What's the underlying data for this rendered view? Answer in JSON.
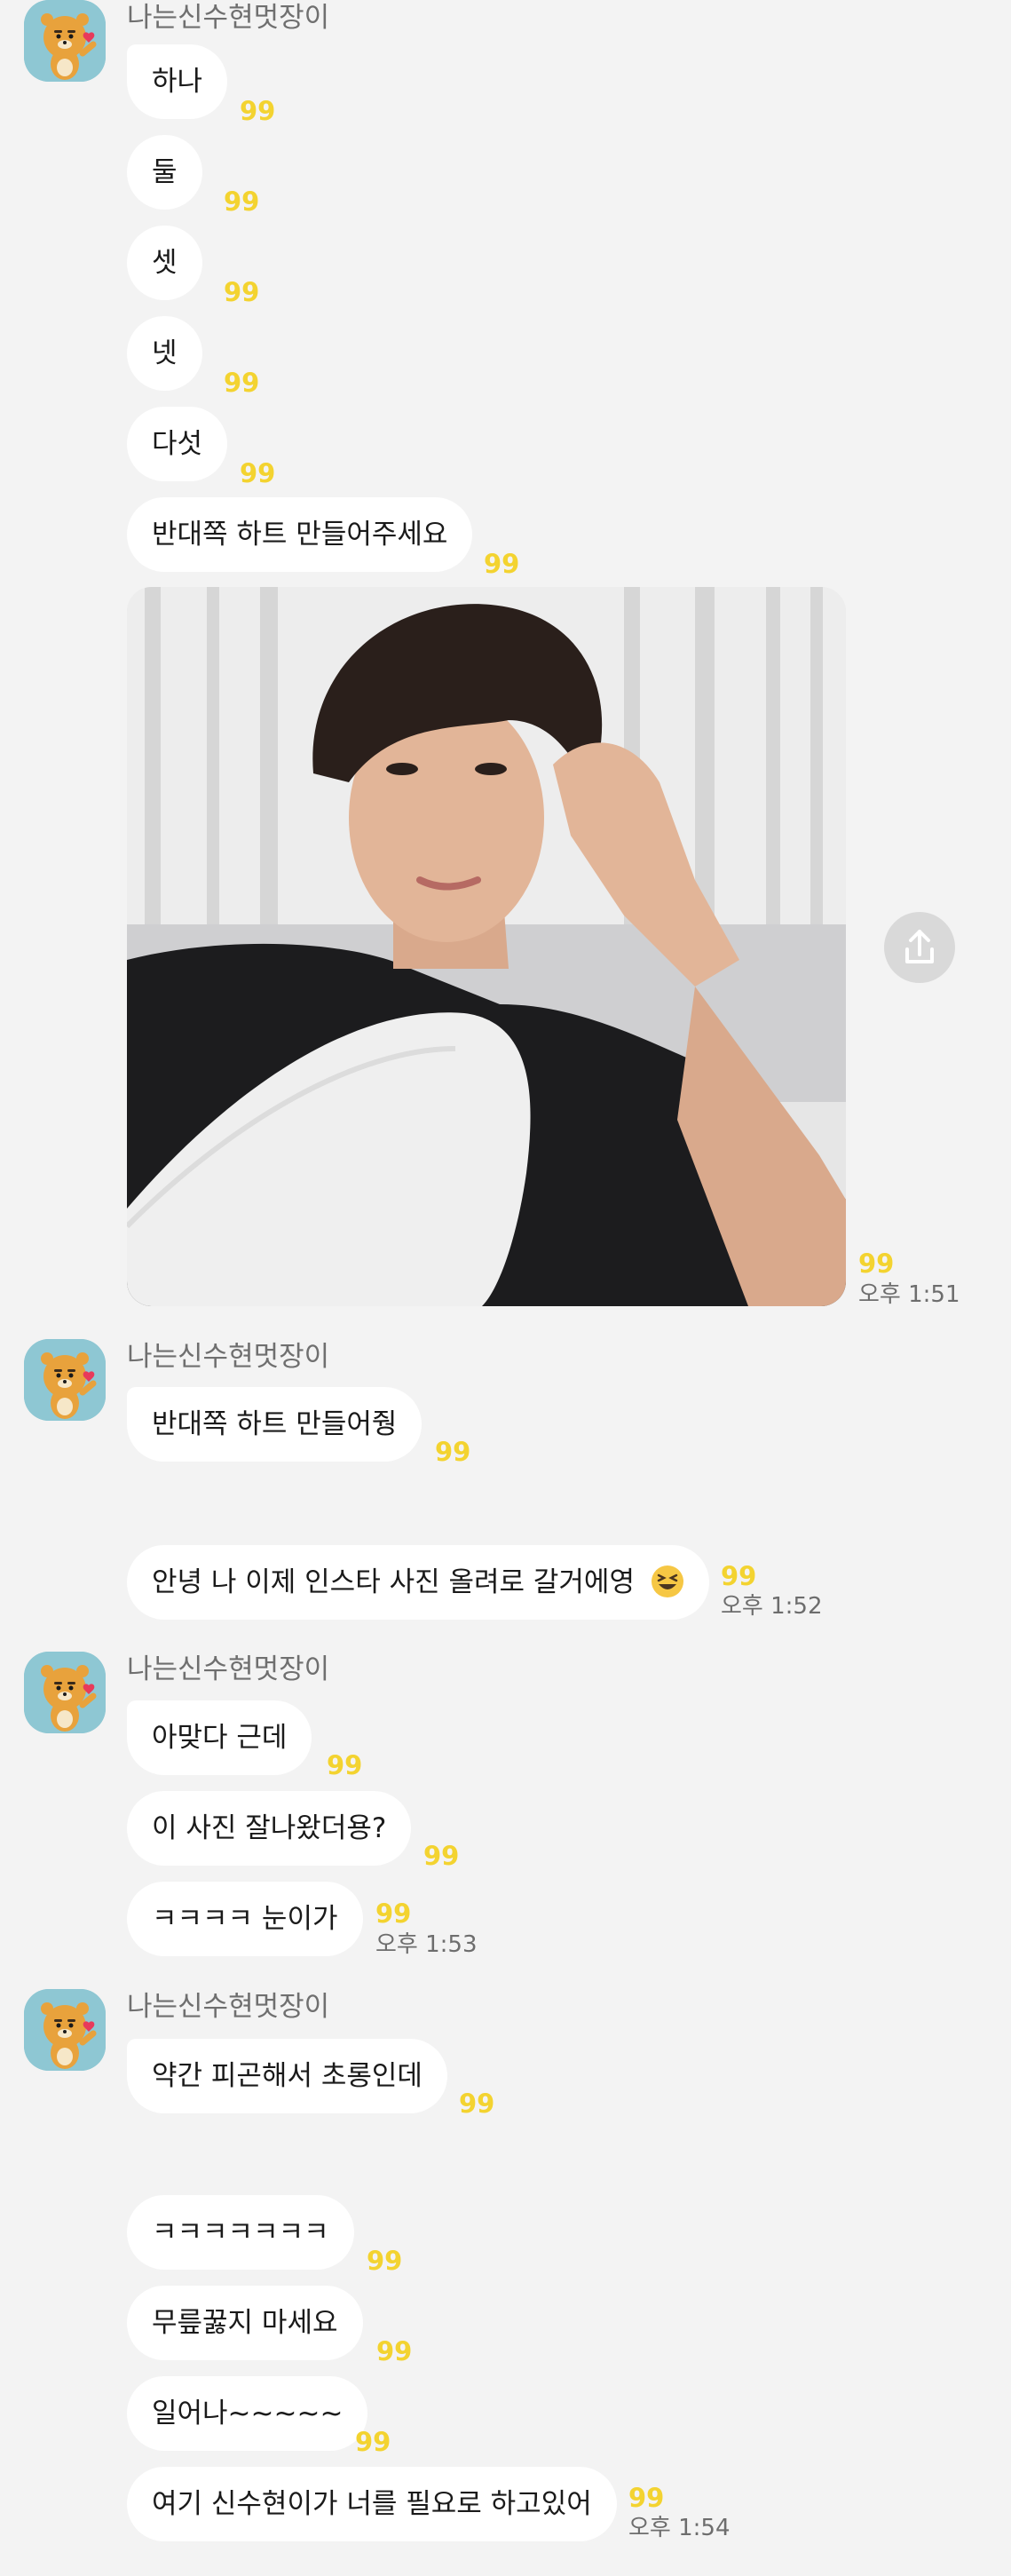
{
  "sender_name": "나는신수현멋장이",
  "messages": {
    "m1": "하나",
    "m2": "둘",
    "m3": "셋",
    "m4": "넷",
    "m5": "다섯",
    "m6": "반대쪽 하트 만들어주세요",
    "m7": "반대쪽 하트 만들어줭",
    "m8": "안녕 나 이제 인스타 사진 올려로 갈거에영",
    "m9": "아맞다 근데",
    "m10": "이 사진 잘나왔더용?",
    "m11": "ㅋㅋㅋㅋ 눈이가",
    "m12": "약간 피곤해서 초롱인데",
    "m13": "ㅋㅋㅋㅋㅋㅋㅋ",
    "m14": "무릎꿇지 마세요",
    "m15": "일어나~~~~~",
    "m16": "여기 신수현이가 너를 필요로 하고있어"
  },
  "unread_count": "99",
  "times": {
    "t1": "오후 1:51",
    "t2": "오후 1:52",
    "t3": "오후 1:53",
    "t4": "오후 1:54"
  },
  "icons": {
    "avatar": "ryan-bear-avatar",
    "share": "share-upload-icon",
    "emoji": "grinning-squinting-face"
  },
  "colors": {
    "background": "#f3f3f3",
    "bubble": "#ffffff",
    "unread": "#f3d330"
  }
}
